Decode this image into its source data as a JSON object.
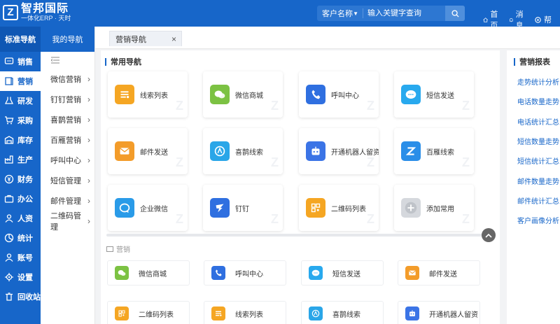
{
  "brand": {
    "mark": "Z",
    "name": "智邦国际",
    "tagline": "一体化ERP · 天时"
  },
  "search": {
    "type": "客户名称",
    "placeholder": "输入关键字查询"
  },
  "top_links": [
    {
      "label": "首页",
      "icon": "home-icon"
    },
    {
      "label": "消息",
      "icon": "bell-icon"
    },
    {
      "label": "帮",
      "icon": "settings-icon"
    }
  ],
  "left_nav": {
    "header": "标准导航",
    "items": [
      {
        "label": "销售",
        "icon": "chat-icon"
      },
      {
        "label": "营销",
        "icon": "book-icon"
      },
      {
        "label": "研发",
        "icon": "flask-icon"
      },
      {
        "label": "采购",
        "icon": "cart-icon"
      },
      {
        "label": "库存",
        "icon": "warehouse-icon"
      },
      {
        "label": "生产",
        "icon": "factory-icon"
      },
      {
        "label": "财务",
        "icon": "finance-icon"
      },
      {
        "label": "办公",
        "icon": "briefcase-icon"
      },
      {
        "label": "人资",
        "icon": "user-icon"
      },
      {
        "label": "统计",
        "icon": "chart-icon"
      },
      {
        "label": "账号",
        "icon": "account-icon"
      },
      {
        "label": "设置",
        "icon": "gear-icon"
      },
      {
        "label": "回收站",
        "icon": "trash-icon"
      }
    ],
    "active": "营销"
  },
  "sub_nav": {
    "header": "我的导航",
    "items": [
      "微信营销",
      "钉钉营销",
      "喜鹊营销",
      "百雁营销",
      "呼叫中心",
      "短信管理",
      "邮件管理",
      "二维码管理"
    ]
  },
  "tabs": [
    {
      "label": "营销导航",
      "close": "×"
    }
  ],
  "common_nav": {
    "title": "常用导航",
    "cards": [
      {
        "label": "线索列表",
        "icon": "clue-list-icon",
        "color": "#f5a623"
      },
      {
        "label": "微信商城",
        "icon": "wechat-icon",
        "color": "#7cc243"
      },
      {
        "label": "呼叫中心",
        "icon": "phone-icon",
        "color": "#2f6fe0"
      },
      {
        "label": "短信发送",
        "icon": "sms-icon",
        "color": "#28a9ee"
      },
      {
        "label": "邮件发送",
        "icon": "mail-icon",
        "color": "#f39c2a"
      },
      {
        "label": "喜鹊线索",
        "icon": "magpie-icon",
        "color": "#2aa6e8"
      },
      {
        "label": "开通机器人留资",
        "icon": "robot-icon",
        "color": "#3b74e6"
      },
      {
        "label": "百雁线索",
        "icon": "z-logo-icon",
        "color": "#2a8ee8"
      },
      {
        "label": "企业微信",
        "icon": "work-wechat-icon",
        "color": "#2a9be8"
      },
      {
        "label": "钉钉",
        "icon": "dingtalk-icon",
        "color": "#2f6fe0"
      },
      {
        "label": "二维码列表",
        "icon": "qrcode-icon",
        "color": "#f5a623"
      },
      {
        "label": "添加常用",
        "icon": "plus-icon",
        "color": "#d5d8dd"
      }
    ]
  },
  "marketing_section": {
    "title": "营销",
    "items": [
      {
        "label": "微信商城",
        "icon": "wechat-icon",
        "color": "#7cc243"
      },
      {
        "label": "呼叫中心",
        "icon": "phone-icon",
        "color": "#2f6fe0"
      },
      {
        "label": "短信发送",
        "icon": "sms-icon",
        "color": "#28a9ee"
      },
      {
        "label": "邮件发送",
        "icon": "mail-icon",
        "color": "#f39c2a"
      },
      {
        "label": "二维码列表",
        "icon": "qrcode-icon",
        "color": "#f5a623"
      },
      {
        "label": "线索列表",
        "icon": "clue-list-icon",
        "color": "#f5a623"
      },
      {
        "label": "喜鹊线索",
        "icon": "magpie-icon",
        "color": "#2aa6e8"
      },
      {
        "label": "开通机器人留资",
        "icon": "robot-icon",
        "color": "#3b74e6"
      }
    ]
  },
  "reports": {
    "title": "营销报表",
    "links": [
      "走势统计分析",
      "电话数量走势",
      "电话统计汇总",
      "短信数量走势",
      "短信统计汇总",
      "邮件数量走势",
      "邮件统计汇总",
      "客户画像分析"
    ]
  }
}
